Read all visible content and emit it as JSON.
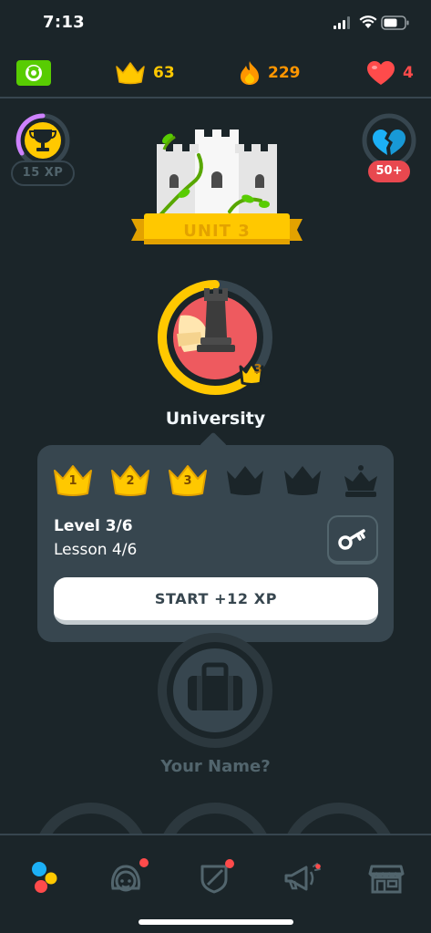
{
  "status_bar": {
    "time": "7:13"
  },
  "stats": {
    "crowns": "63",
    "streak": "229",
    "hearts": "4"
  },
  "xp_badge": {
    "label": "15 XP"
  },
  "hearts_badge": {
    "label": "50+"
  },
  "unit": {
    "label": "UNIT 3"
  },
  "skill": {
    "title": "University",
    "crown_level": "3"
  },
  "popup": {
    "crowns": [
      {
        "number": "1",
        "state": "earned"
      },
      {
        "number": "2",
        "state": "earned"
      },
      {
        "number": "3",
        "state": "earned"
      },
      {
        "number": "",
        "state": "locked"
      },
      {
        "number": "",
        "state": "locked"
      },
      {
        "number": "",
        "state": "legendary-locked"
      }
    ],
    "level": "Level 3/6",
    "lesson": "Lesson 4/6",
    "start_label": "START +12 XP"
  },
  "next_skill": {
    "title": "Your Name?"
  },
  "nav": [
    {
      "name": "learn",
      "icon": "learn-dots-icon",
      "active": true
    },
    {
      "name": "profile",
      "icon": "profile-icon",
      "dot": true
    },
    {
      "name": "leagues",
      "icon": "shield-icon",
      "dot": true
    },
    {
      "name": "announcements",
      "icon": "megaphone-icon"
    },
    {
      "name": "shop",
      "icon": "shop-icon"
    }
  ],
  "colors": {
    "background": "#1b2529",
    "card": "#37464f",
    "gold": "#ffc800",
    "red": "#ff4b4b",
    "orange": "#ff9600",
    "blue": "#1cb0f6"
  }
}
